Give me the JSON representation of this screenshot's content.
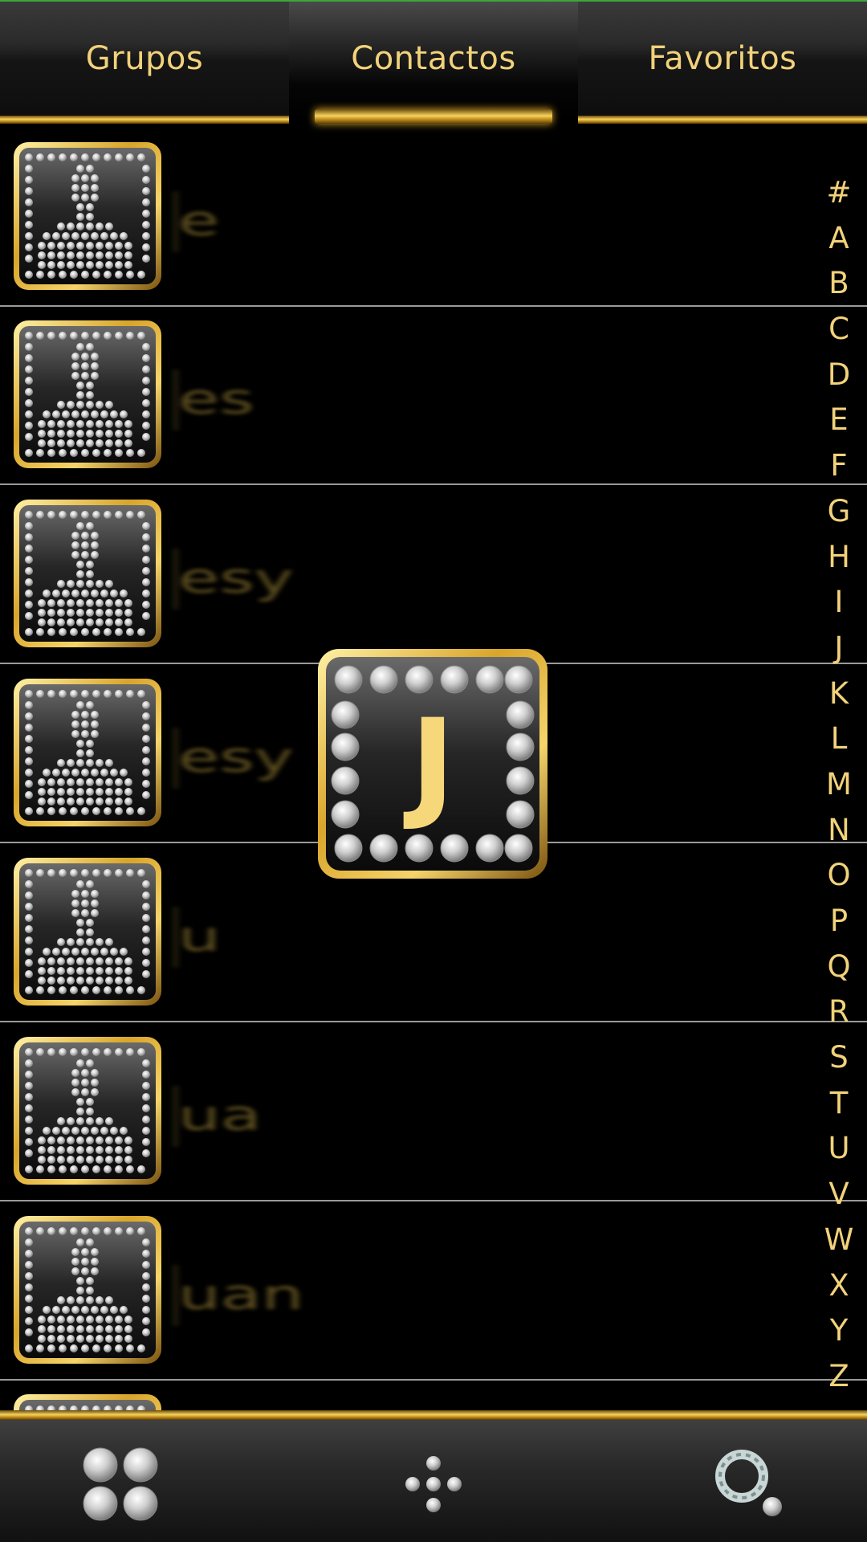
{
  "tabs": [
    {
      "label": "Grupos",
      "selected": false
    },
    {
      "label": "Contactos",
      "selected": true
    },
    {
      "label": "Favoritos",
      "selected": false
    }
  ],
  "contacts": [
    {
      "name": "e"
    },
    {
      "name": "es"
    },
    {
      "name": "esy"
    },
    {
      "name": "esy"
    },
    {
      "name": "u"
    },
    {
      "name": "ua"
    },
    {
      "name": "uan"
    }
  ],
  "index_letters": [
    "#",
    "A",
    "B",
    "C",
    "D",
    "E",
    "F",
    "G",
    "H",
    "I",
    "J",
    "K",
    "L",
    "M",
    "N",
    "O",
    "P",
    "Q",
    "R",
    "S",
    "T",
    "U",
    "V",
    "W",
    "X",
    "Y",
    "Z"
  ],
  "popup": {
    "letter": "J"
  },
  "bottom_bar": [
    {
      "icon": "grid-icon"
    },
    {
      "icon": "dialpad-icon"
    },
    {
      "icon": "search-icon"
    }
  ],
  "colors": {
    "accent": "#f2d27a",
    "gold": "#d9a52a",
    "background": "#000000"
  }
}
